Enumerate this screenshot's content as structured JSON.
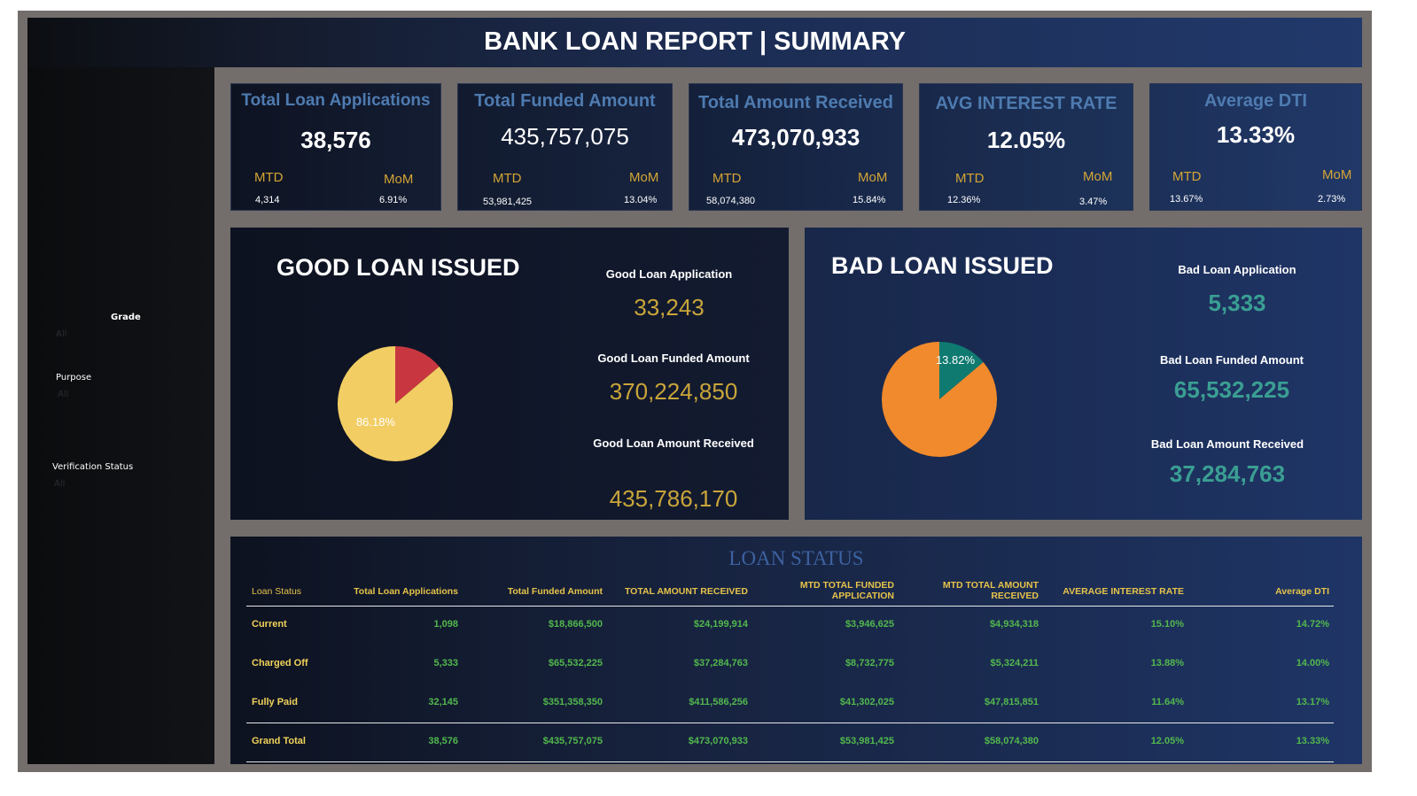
{
  "header": {
    "title": "BANK LOAN REPORT | SUMMARY"
  },
  "slicers": [
    {
      "label": "Grade",
      "value": "All"
    },
    {
      "label": "Purpose",
      "value": "All"
    },
    {
      "label": "Verification Status",
      "value": "All"
    }
  ],
  "kpis": [
    {
      "title": "Total Loan Applications",
      "value": "38,576",
      "mtd_label": "MTD",
      "mtd": "4,314",
      "mom_label": "MoM",
      "mom": "6.91%"
    },
    {
      "title": "Total Funded Amount",
      "value": "435,757,075",
      "mtd_label": "MTD",
      "mtd": "53,981,425",
      "mom_label": "MoM",
      "mom": "13.04%"
    },
    {
      "title": "Total Amount Received",
      "value": "473,070,933",
      "mtd_label": "MTD",
      "mtd": "58,074,380",
      "mom_label": "MoM",
      "mom": "15.84%"
    },
    {
      "title": "AVG INTEREST RATE",
      "value": "12.05%",
      "mtd_label": "MTD",
      "mtd": "12.36%",
      "mom_label": "MoM",
      "mom": "3.47%"
    },
    {
      "title": "Average DTI",
      "value": "13.33%",
      "mtd_label": "MTD",
      "mtd": "13.67%",
      "mom_label": "MoM",
      "mom": "2.73%"
    }
  ],
  "good_loan": {
    "title": "GOOD LOAN ISSUED",
    "application_label": "Good Loan Application",
    "application": "33,243",
    "funded_label": "Good Loan Funded Amount",
    "funded": "370,224,850",
    "received_label": "Good Loan Amount Received",
    "received": "435,786,170",
    "pie_label": "86.18%"
  },
  "bad_loan": {
    "title": "BAD LOAN ISSUED",
    "application_label": "Bad Loan Application",
    "application": "5,333",
    "funded_label": "Bad Loan Funded Amount",
    "funded": "65,532,225",
    "received_label": "Bad Loan Amount Received",
    "received": "37,284,763",
    "pie_label": "13.82%"
  },
  "chart_data": [
    {
      "type": "pie",
      "title": "GOOD LOAN ISSUED",
      "slices": [
        {
          "value": 86.18,
          "color": "#f2cd63"
        },
        {
          "value": 13.82,
          "color": "#c8373f"
        }
      ],
      "data_labels": [
        "86.18%"
      ]
    },
    {
      "type": "pie",
      "title": "BAD LOAN ISSUED",
      "slices": [
        {
          "value": 13.82,
          "color": "#0f7a70"
        },
        {
          "value": 86.18,
          "color": "#f08a2c"
        }
      ],
      "data_labels": [
        "13.82%"
      ]
    },
    {
      "type": "table",
      "title": "LOAN STATUS",
      "columns": [
        "Loan Status",
        "Total Loan Applications",
        "Total Funded Amount",
        "TOTAL AMOUNT RECEIVED",
        "MTD TOTAL FUNDED APPLICATION",
        "MTD TOTAL AMOUNT RECEIVED",
        "AVERAGE INTEREST RATE",
        "Average DTI"
      ],
      "rows": [
        [
          "Current",
          "1,098",
          "$18,866,500",
          "$24,199,914",
          "$3,946,625",
          "$4,934,318",
          "15.10%",
          "14.72%"
        ],
        [
          "Charged Off",
          "5,333",
          "$65,532,225",
          "$37,284,763",
          "$8,732,775",
          "$5,324,211",
          "13.88%",
          "14.00%"
        ],
        [
          "Fully Paid",
          "32,145",
          "$351,358,350",
          "$411,586,256",
          "$41,302,025",
          "$47,815,851",
          "11.64%",
          "13.17%"
        ],
        [
          "Grand Total",
          "38,576",
          "$435,757,075",
          "$473,070,933",
          "$53,981,425",
          "$58,074,380",
          "12.05%",
          "13.33%"
        ]
      ]
    }
  ],
  "colors": {
    "good_accent": "#c9a53a",
    "bad_accent": "#3a9f93",
    "kpi_title": "#4e7bb0",
    "mtd_label": "#d4a535"
  }
}
